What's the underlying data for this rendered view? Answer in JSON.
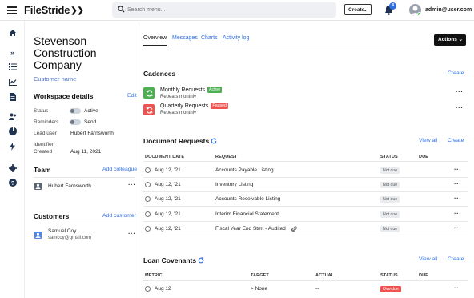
{
  "app": {
    "brand": "FileStride"
  },
  "header": {
    "search_placeholder": "Search menu...",
    "create_label": "Create",
    "notification_count": "4",
    "user_email": "admin@user.com"
  },
  "customer": {
    "name": "Stevenson Construction Company",
    "subtitle": "Customer name"
  },
  "workspace": {
    "title": "Workspace details",
    "edit_label": "Edit",
    "status_label": "Status",
    "status_value": "Active",
    "reminders_label": "Reminders",
    "reminders_value": "Send",
    "lead_label": "Lead user",
    "lead_value": "Hubert Farnsworth",
    "identifier_label": "Identifier",
    "created_label": "Created",
    "created_value": "Aug 11, 2021"
  },
  "team": {
    "title": "Team",
    "add_label": "Add colleague",
    "members": [
      {
        "name": "Hubert Farnsworth"
      }
    ]
  },
  "customers": {
    "title": "Customers",
    "add_label": "Add customer",
    "people": [
      {
        "name": "Samuel Coy",
        "email": "samcoy@gmail.com"
      }
    ]
  },
  "tabs": [
    {
      "label": "Overview"
    },
    {
      "label": "Messages"
    },
    {
      "label": "Charts"
    },
    {
      "label": "Activity log"
    }
  ],
  "actions_label": "Actions",
  "cadences": {
    "title": "Cadences",
    "create_label": "Create",
    "items": [
      {
        "name": "Monthly Requests",
        "badge": "Active",
        "badge_color": "#4caf50",
        "sub": "Repeats monthly",
        "icon_color": "#4caf50"
      },
      {
        "name": "Quarterly Requests",
        "badge": "Paused",
        "badge_color": "#ef5350",
        "sub": "Repeats monthly",
        "icon_color": "#ef5350"
      }
    ]
  },
  "document_requests": {
    "title": "Document Requests",
    "view_all_label": "View all",
    "create_label": "Create",
    "columns": {
      "date": "DOCUMENT DATE",
      "request": "REQUEST",
      "status": "STATUS",
      "due": "DUE"
    },
    "rows": [
      {
        "date": "Aug 12, '21",
        "request": "Accounts Payable Listing",
        "status": "Not due"
      },
      {
        "date": "Aug 12, '21",
        "request": "Inventory Listing",
        "status": "Not due"
      },
      {
        "date": "Aug 12, '21",
        "request": "Accounts Receivable Listing",
        "status": "Not due"
      },
      {
        "date": "Aug 12, '21",
        "request": "Interim Financial Statement",
        "status": "Not due"
      },
      {
        "date": "Aug 12, '21",
        "request": "Fiscal Year End Stmt - Audited",
        "status": "Not due",
        "attachment": true
      }
    ]
  },
  "loan_covenants": {
    "title": "Loan Covenants",
    "view_all_label": "View all",
    "create_label": "Create",
    "columns": {
      "metric": "METRIC",
      "target": "TARGET",
      "actual": "ACTUAL",
      "status": "STATUS",
      "due": "DUE"
    },
    "rows": [
      {
        "metric": "Aug 12",
        "target": "> None",
        "actual": "--",
        "status": "Overdue"
      }
    ]
  },
  "colors": {
    "accent": "#2f6fe0",
    "active": "#4caf50",
    "paused": "#ef5350",
    "rail_icon": "#1f3350"
  }
}
